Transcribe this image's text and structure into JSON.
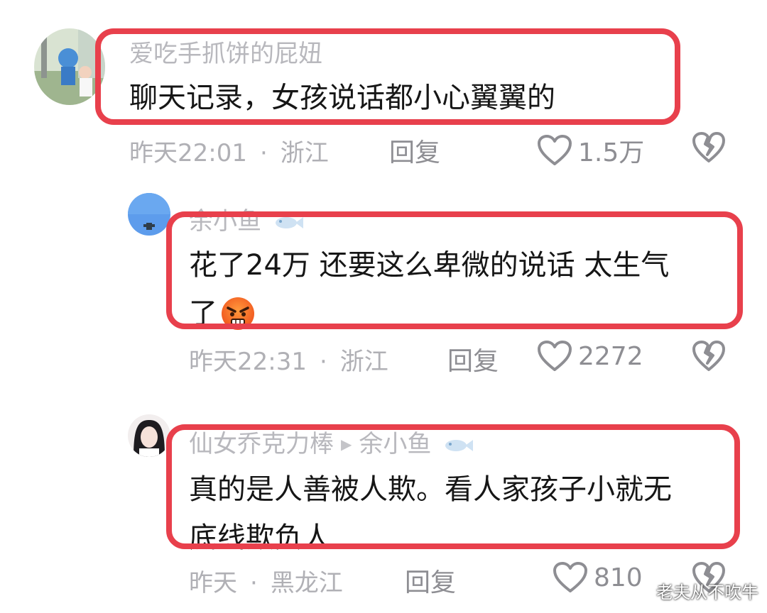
{
  "comments": [
    {
      "username": "爱吃手抓饼的屁妞",
      "content_lines": [
        "聊天记录，女孩说话都小心翼翼的"
      ],
      "time": "昨天22:01",
      "location": "浙江",
      "reply_label": "回复",
      "likes": "1.5万"
    },
    {
      "username": "余小鱼",
      "content_lines": [
        "花了24万 还要这么卑微的说话 太生气",
        "了"
      ],
      "emoji": "angry-face",
      "time": "昨天22:31",
      "location": "浙江",
      "reply_label": "回复",
      "likes": "2272"
    },
    {
      "username": "仙女乔克力棒",
      "reply_to": "余小鱼",
      "content_lines": [
        "真的是人善被人欺。看人家孩子小就无",
        "底线欺负人"
      ],
      "time": "昨天",
      "location": "黑龙江",
      "reply_label": "回复",
      "likes": "810"
    }
  ],
  "meta_separator": "·",
  "watermark": "老夫从不吹牛",
  "colors": {
    "highlight": "#e8404c",
    "muted": "#b0b0b5"
  }
}
